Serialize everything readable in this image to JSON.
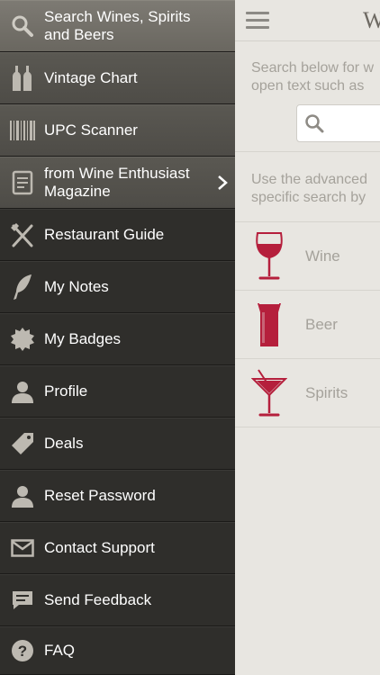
{
  "sidebar": {
    "items": [
      {
        "label": "Search Wines, Spirits and Beers",
        "icon": "search-icon",
        "state": "selected"
      },
      {
        "label": "Vintage Chart",
        "icon": "bottles-icon"
      },
      {
        "label": "UPC Scanner",
        "icon": "barcode-icon"
      },
      {
        "label": "from Wine Enthusiast Magazine",
        "icon": "magazine-icon",
        "has_chevron": true
      },
      {
        "label": "Restaurant Guide",
        "icon": "fork-knife-icon"
      },
      {
        "label": "My Notes",
        "icon": "quill-icon"
      },
      {
        "label": "My Badges",
        "icon": "badge-icon"
      },
      {
        "label": "Profile",
        "icon": "person-icon"
      },
      {
        "label": "Deals",
        "icon": "tag-icon"
      },
      {
        "label": "Reset Password",
        "icon": "person-icon"
      },
      {
        "label": "Contact Support",
        "icon": "envelope-icon"
      },
      {
        "label": "Send Feedback",
        "icon": "chat-icon"
      },
      {
        "label": "FAQ",
        "icon": "help-icon"
      }
    ]
  },
  "main": {
    "brand": "Wi",
    "search_info": {
      "line1": "Search below for w",
      "line2": "open text such as"
    },
    "advanced_info": {
      "line1": "Use the advanced",
      "line2": "specific search by"
    },
    "categories": [
      {
        "label": "Wine",
        "icon": "wine-glass-icon"
      },
      {
        "label": "Beer",
        "icon": "beer-glass-icon"
      },
      {
        "label": "Spirits",
        "icon": "martini-glass-icon"
      }
    ]
  },
  "colors": {
    "accent_red": "#b51f3c",
    "sidebar_bg": "#2f2e2b",
    "main_bg": "#e8e6e1"
  }
}
